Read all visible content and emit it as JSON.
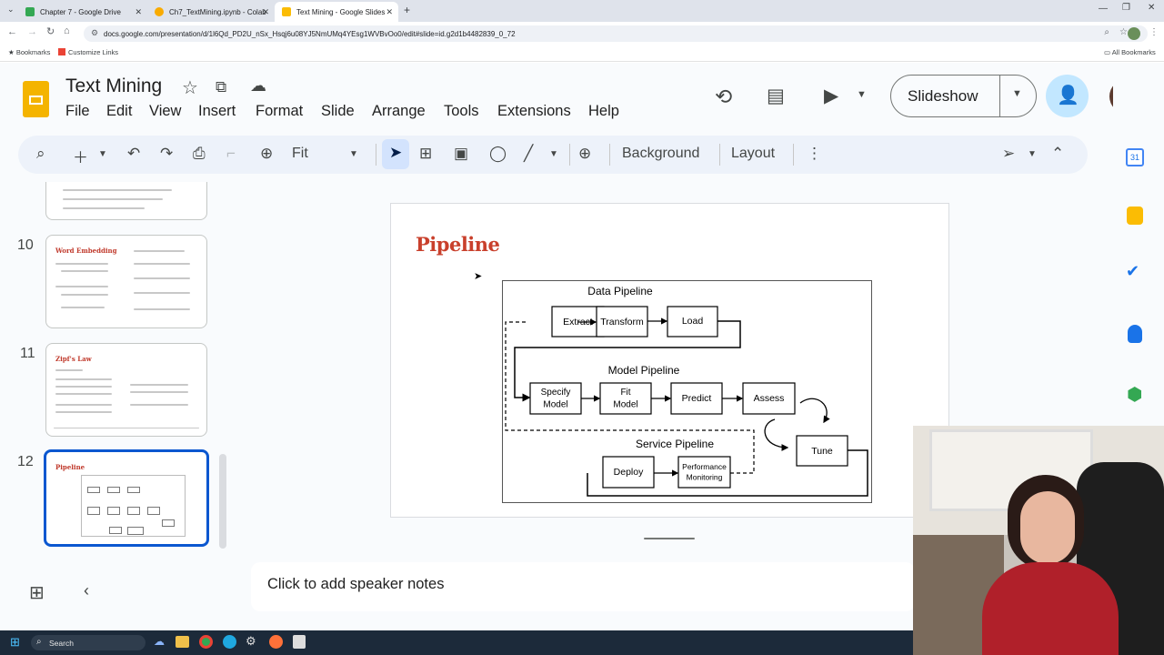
{
  "browser": {
    "tabs": [
      {
        "label": "Chapter 7 - Google Drive",
        "active": false,
        "fav_color": "#34a853"
      },
      {
        "label": "Ch7_TextMining.ipynb - Colab",
        "active": false,
        "fav_color": "#f9ab00"
      },
      {
        "label": "Text Mining - Google Slides",
        "active": true,
        "fav_color": "#fbbc04"
      }
    ],
    "url": "docs.google.com/presentation/d/1l6Qd_PD2U_nSx_Hsqj6u08YJ5NmUMq4YEsg1WVBvOo0/edit#slide=id.g2d1b4482839_0_72",
    "bookmarks": [
      "Bookmarks",
      "Customize Links"
    ],
    "all_bookmarks": "All Bookmarks"
  },
  "app": {
    "title": "Text Mining",
    "menu": [
      "File",
      "Edit",
      "View",
      "Insert",
      "Format",
      "Slide",
      "Arrange",
      "Tools",
      "Extensions",
      "Help"
    ],
    "slideshow_label": "Slideshow",
    "toolbar": {
      "zoom": "Fit",
      "background": "Background",
      "layout": "Layout"
    },
    "notes_placeholder": "Click to add speaker notes"
  },
  "filmstrip": [
    {
      "number": "10",
      "title": "Word Embedding"
    },
    {
      "number": "11",
      "title": "Zipf's Law"
    },
    {
      "number": "12",
      "title": "Pipeline"
    }
  ],
  "slide": {
    "title": "Pipeline",
    "diagram": {
      "data_pipeline": {
        "label": "Data Pipeline",
        "steps": [
          "Extract",
          "Transform",
          "Load"
        ]
      },
      "model_pipeline": {
        "label": "Model Pipeline",
        "steps": [
          "Specify Model",
          "Fit Model",
          "Predict",
          "Assess"
        ]
      },
      "tune": "Tune",
      "service_pipeline": {
        "label": "Service Pipeline",
        "steps": [
          "Deploy",
          "Performance Monitoring"
        ]
      }
    }
  },
  "taskbar": {
    "search": "Search"
  },
  "colors": {
    "accent": "#0b57d0",
    "slide_title": "#c9402c",
    "slides_yellow": "#f4b400"
  }
}
